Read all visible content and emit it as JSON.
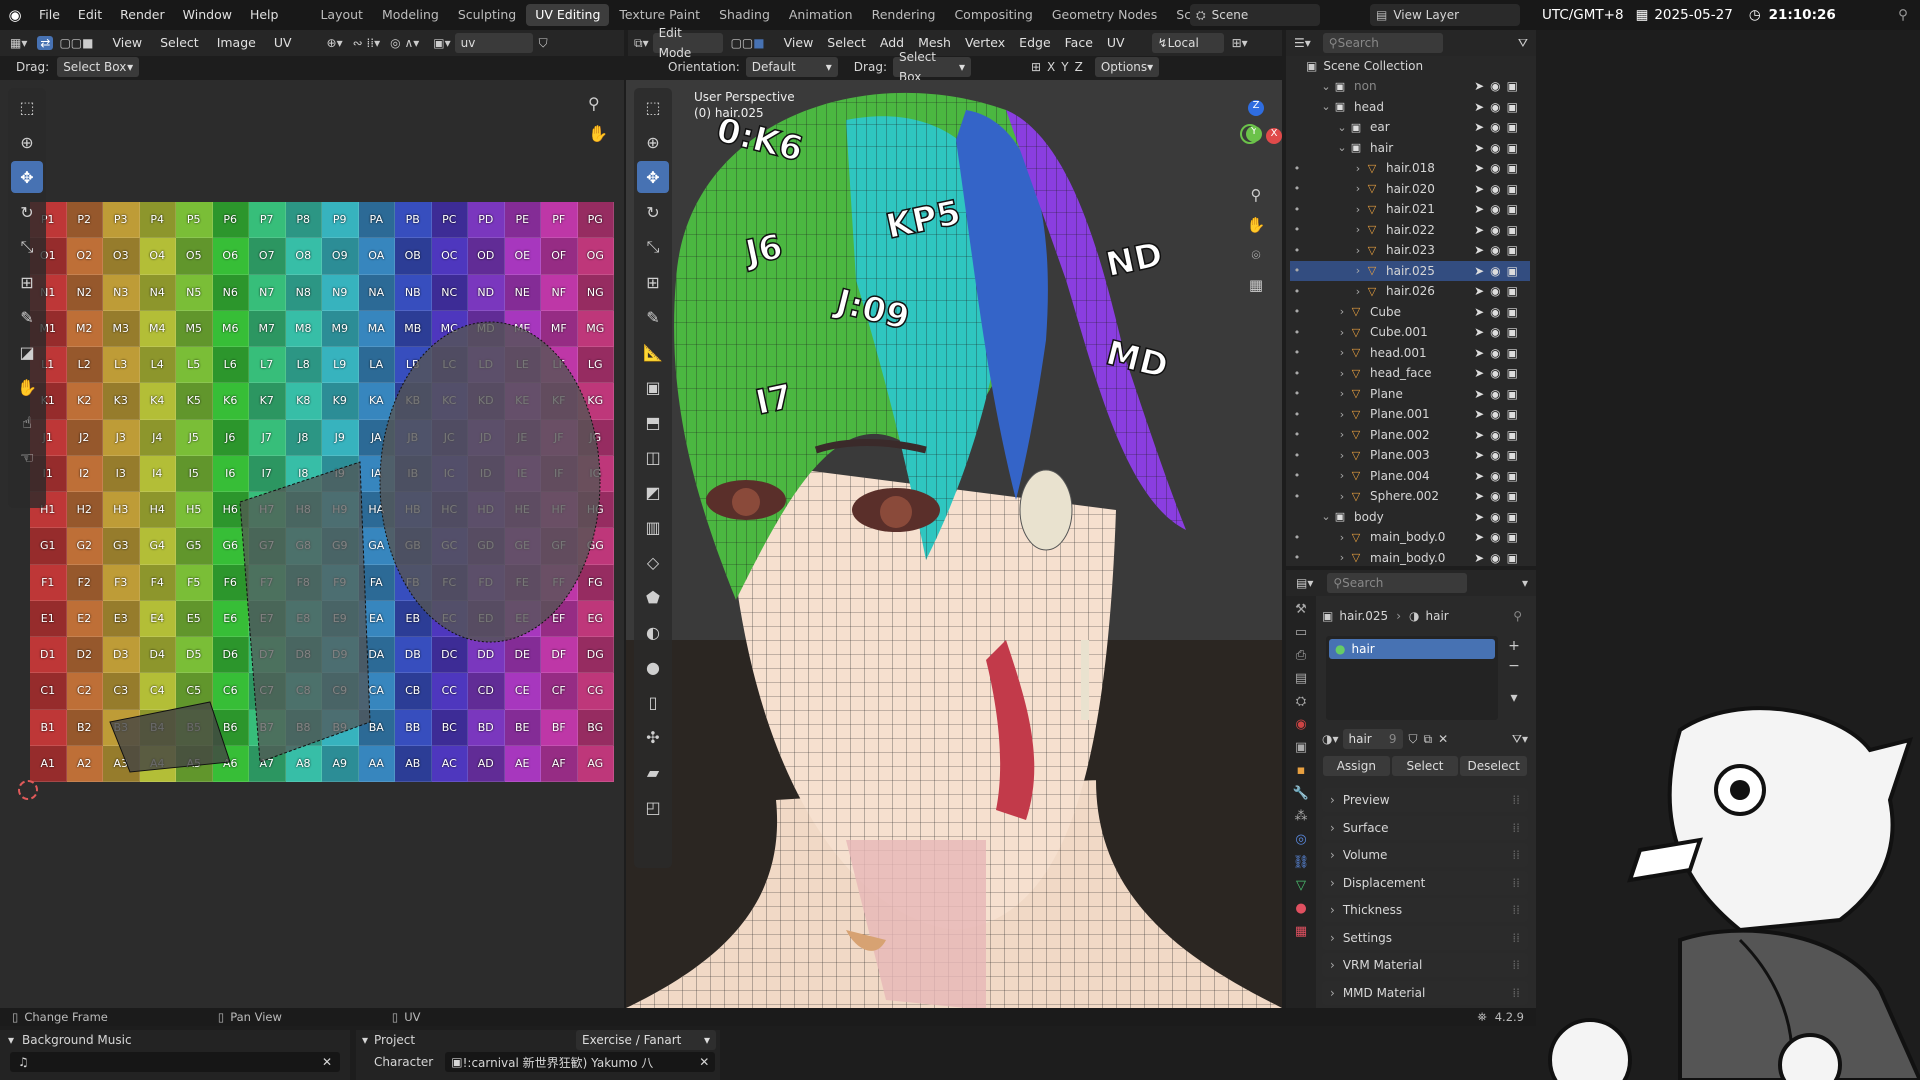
{
  "menu": [
    "File",
    "Edit",
    "Render",
    "Window",
    "Help"
  ],
  "workspaces": [
    "Layout",
    "Modeling",
    "Sculpting",
    "UV Editing",
    "Texture Paint",
    "Shading",
    "Animation",
    "Rendering",
    "Compositing",
    "Geometry Nodes",
    "Scripting"
  ],
  "active_workspace": "UV Editing",
  "scene": {
    "label": "Scene",
    "view_layer": "View Layer"
  },
  "clock": {
    "tz": "UTC/GMT+8",
    "date": "2025-05-27",
    "time": "21:10:26"
  },
  "uv_editor": {
    "menus": [
      "View",
      "Select",
      "Image",
      "UV"
    ],
    "image_name": "uv",
    "drag_label": "Drag:",
    "drag_value": "Select Box",
    "grid_rows": [
      [
        "P1",
        "P2",
        "P3",
        "P4",
        "P5",
        "P6",
        "P7",
        "P8",
        "P9",
        "PA",
        "PB",
        "PC",
        "PD",
        "PE",
        "PF",
        "PG"
      ],
      [
        "O1",
        "O2",
        "O3",
        "O4",
        "O5",
        "O6",
        "O7",
        "O8",
        "O9",
        "OA",
        "OB",
        "OC",
        "OD",
        "OE",
        "OF",
        "OG"
      ],
      [
        "N1",
        "N2",
        "N3",
        "N4",
        "N5",
        "N6",
        "N7",
        "N8",
        "N9",
        "NA",
        "NB",
        "NC",
        "ND",
        "NE",
        "NF",
        "NG"
      ],
      [
        "M1",
        "M2",
        "M3",
        "M4",
        "M5",
        "M6",
        "M7",
        "M8",
        "M9",
        "MA",
        "MB",
        "MC",
        "MD",
        "ME",
        "MF",
        "MG"
      ],
      [
        "L1",
        "L2",
        "L3",
        "L4",
        "L5",
        "L6",
        "L7",
        "L8",
        "L9",
        "LA",
        "LB",
        "LC",
        "LD",
        "LE",
        "LF",
        "LG"
      ],
      [
        "K1",
        "K2",
        "K3",
        "K4",
        "K5",
        "K6",
        "K7",
        "K8",
        "K9",
        "KA",
        "KB",
        "KC",
        "KD",
        "KE",
        "KF",
        "KG"
      ],
      [
        "J1",
        "J2",
        "J3",
        "J4",
        "J5",
        "J6",
        "J7",
        "J8",
        "J9",
        "JA",
        "JB",
        "JC",
        "JD",
        "JE",
        "JF",
        "JG"
      ],
      [
        "I1",
        "I2",
        "I3",
        "I4",
        "I5",
        "I6",
        "I7",
        "I8",
        "I9",
        "IA",
        "IB",
        "IC",
        "ID",
        "IE",
        "IF",
        "IG"
      ],
      [
        "H1",
        "H2",
        "H3",
        "H4",
        "H5",
        "H6",
        "H7",
        "H8",
        "H9",
        "HA",
        "HB",
        "HC",
        "HD",
        "HE",
        "HF",
        "HG"
      ],
      [
        "G1",
        "G2",
        "G3",
        "G4",
        "G5",
        "G6",
        "G7",
        "G8",
        "G9",
        "GA",
        "GB",
        "GC",
        "GD",
        "GE",
        "GF",
        "GG"
      ],
      [
        "F1",
        "F2",
        "F3",
        "F4",
        "F5",
        "F6",
        "F7",
        "F8",
        "F9",
        "FA",
        "FB",
        "FC",
        "FD",
        "FE",
        "FF",
        "FG"
      ],
      [
        "E1",
        "E2",
        "E3",
        "E4",
        "E5",
        "E6",
        "E7",
        "E8",
        "E9",
        "EA",
        "EB",
        "EC",
        "ED",
        "EE",
        "EF",
        "EG"
      ],
      [
        "D1",
        "D2",
        "D3",
        "D4",
        "D5",
        "D6",
        "D7",
        "D8",
        "D9",
        "DA",
        "DB",
        "DC",
        "DD",
        "DE",
        "DF",
        "DG"
      ],
      [
        "C1",
        "C2",
        "C3",
        "C4",
        "C5",
        "C6",
        "C7",
        "C8",
        "C9",
        "CA",
        "CB",
        "CC",
        "CD",
        "CE",
        "CF",
        "CG"
      ],
      [
        "B1",
        "B2",
        "B3",
        "B4",
        "B5",
        "B6",
        "B7",
        "B8",
        "B9",
        "BA",
        "BB",
        "BC",
        "BD",
        "BE",
        "BF",
        "BG"
      ],
      [
        "A1",
        "A2",
        "A3",
        "A4",
        "A5",
        "A6",
        "A7",
        "A8",
        "A9",
        "AA",
        "AB",
        "AC",
        "AD",
        "AE",
        "AF",
        "AG"
      ]
    ]
  },
  "viewport": {
    "mode": "Edit Mode",
    "menus": [
      "View",
      "Select",
      "Add",
      "Mesh",
      "Vertex",
      "Edge",
      "Face",
      "UV"
    ],
    "orientation_label": "Orientation:",
    "orientation_value": "Default",
    "drag_label": "Drag:",
    "drag_value": "Select Box",
    "transform_space": "Local",
    "options_label": "Options",
    "axes": [
      "X",
      "Y",
      "Z"
    ],
    "perspective": "User Perspective",
    "object": "(0) hair.025",
    "tex_labels": [
      "J6",
      "J:09",
      "KP5",
      "0:K6",
      "ND",
      "MD",
      "I7"
    ]
  },
  "outliner": {
    "search_placeholder": "Search",
    "root": "Scene Collection",
    "rows": [
      {
        "name": "non",
        "indent": 1,
        "type": "collection",
        "dim": true
      },
      {
        "name": "head",
        "indent": 1,
        "type": "collection"
      },
      {
        "name": "ear",
        "indent": 2,
        "type": "collection"
      },
      {
        "name": "hair",
        "indent": 2,
        "type": "collection"
      },
      {
        "name": "hair.018",
        "indent": 3,
        "type": "mesh",
        "selected": true
      },
      {
        "name": "hair.020",
        "indent": 3,
        "type": "mesh"
      },
      {
        "name": "hair.021",
        "indent": 3,
        "type": "mesh"
      },
      {
        "name": "hair.022",
        "indent": 3,
        "type": "mesh"
      },
      {
        "name": "hair.023",
        "indent": 3,
        "type": "mesh"
      },
      {
        "name": "hair.025",
        "indent": 3,
        "type": "mesh",
        "active": true
      },
      {
        "name": "hair.026",
        "indent": 3,
        "type": "mesh"
      },
      {
        "name": "Cube",
        "indent": 2,
        "type": "mesh"
      },
      {
        "name": "Cube.001",
        "indent": 2,
        "type": "mesh"
      },
      {
        "name": "head.001",
        "indent": 2,
        "type": "mesh"
      },
      {
        "name": "head_face",
        "indent": 2,
        "type": "mesh"
      },
      {
        "name": "Plane",
        "indent": 2,
        "type": "mesh"
      },
      {
        "name": "Plane.001",
        "indent": 2,
        "type": "mesh"
      },
      {
        "name": "Plane.002",
        "indent": 2,
        "type": "mesh"
      },
      {
        "name": "Plane.003",
        "indent": 2,
        "type": "mesh"
      },
      {
        "name": "Plane.004",
        "indent": 2,
        "type": "mesh"
      },
      {
        "name": "Sphere.002",
        "indent": 2,
        "type": "mesh"
      },
      {
        "name": "body",
        "indent": 1,
        "type": "collection"
      },
      {
        "name": "main_body.0",
        "indent": 2,
        "type": "mesh"
      },
      {
        "name": "main_body.0",
        "indent": 2,
        "type": "mesh"
      }
    ]
  },
  "properties": {
    "search_placeholder": "Search",
    "breadcrumb_object": "hair.025",
    "breadcrumb_material": "hair",
    "slot_name": "hair",
    "material_name": "hair",
    "users": "9",
    "buttons": {
      "assign": "Assign",
      "select": "Select",
      "deselect": "Deselect"
    },
    "panels": [
      "Preview",
      "Surface",
      "Volume",
      "Displacement",
      "Thickness",
      "Settings",
      "VRM Material",
      "MMD Material"
    ]
  },
  "status": {
    "change_frame": "Change Frame",
    "pan_view": "Pan View",
    "uv": "UV",
    "version": "4.2.9"
  },
  "bottom": {
    "bgm_title": "Background Music",
    "project_title": "Project",
    "project_value": "Exercise / Fanart",
    "character_label": "Character",
    "character_value": "!:carnival 新世界狂歓) Yakumo 八"
  },
  "colors": {
    "accent": "#4772b3",
    "selected_row": "#334d80",
    "bg": "#1d1d1d",
    "panel": "#262626"
  }
}
